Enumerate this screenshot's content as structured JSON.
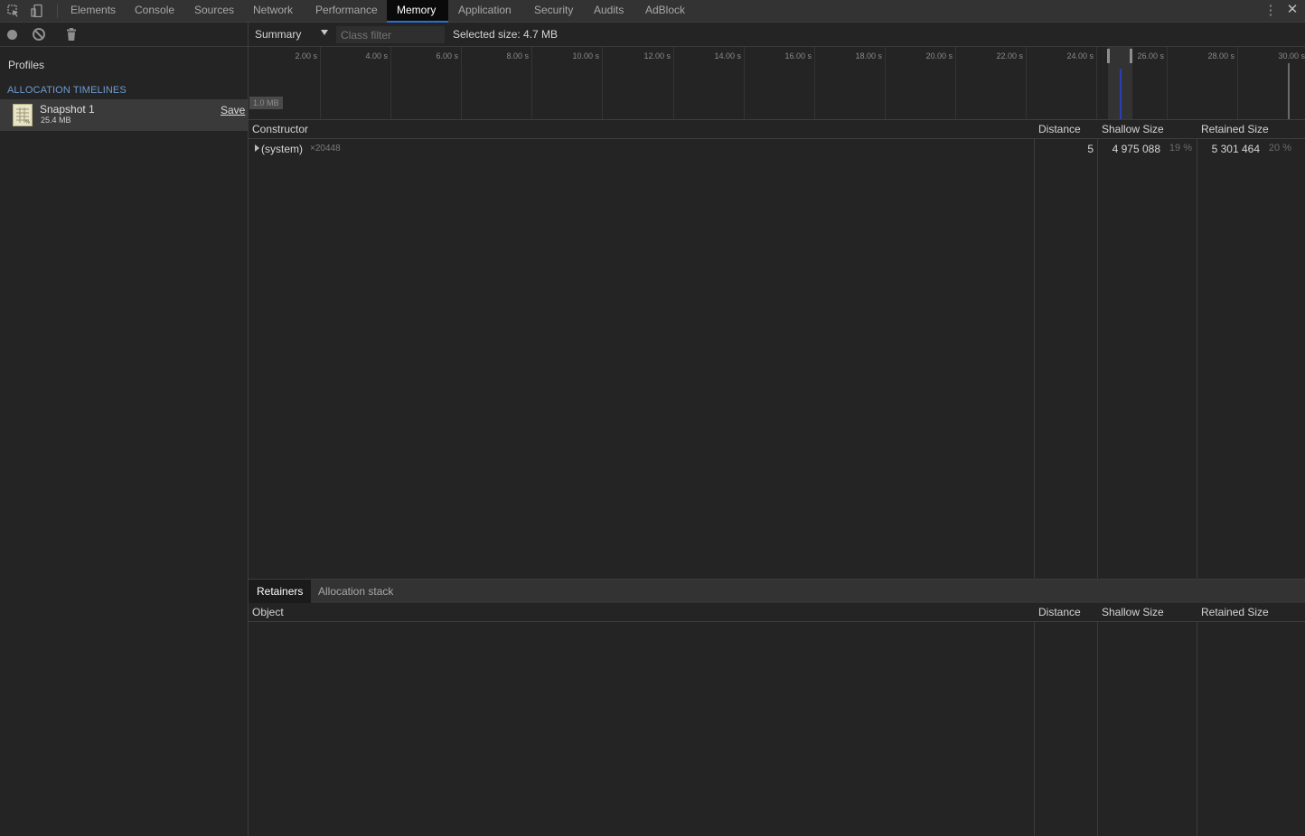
{
  "tabs": [
    "Elements",
    "Console",
    "Sources",
    "Network",
    "Performance",
    "Memory",
    "Application",
    "Security",
    "Audits",
    "AdBlock"
  ],
  "active_tab": "Memory",
  "sidebar": {
    "title": "Profiles",
    "section_header": "ALLOCATION TIMELINES",
    "snapshot": {
      "name": "Snapshot 1",
      "size": "25.4 MB",
      "save_label": "Save"
    }
  },
  "toolbar": {
    "view": "Summary",
    "class_filter_placeholder": "Class filter",
    "selected_size": "Selected size: 4.7 MB"
  },
  "timeline": {
    "ticks": [
      "2.00 s",
      "4.00 s",
      "6.00 s",
      "8.00 s",
      "10.00 s",
      "12.00 s",
      "14.00 s",
      "16.00 s",
      "18.00 s",
      "20.00 s",
      "22.00 s",
      "24.00 s",
      "26.00 s",
      "28.00 s",
      "30.00 s"
    ],
    "memory_label": "1.0 MB"
  },
  "grid": {
    "headers": {
      "constructor": "Constructor",
      "distance": "Distance",
      "shallow": "Shallow Size",
      "retained": "Retained Size"
    },
    "rows": [
      {
        "name": "(system)",
        "count": "×20448",
        "distance": "5",
        "shallow": "4 975 088",
        "shallow_pct": "19 %",
        "retained": "5 301 464",
        "retained_pct": "20 %"
      }
    ]
  },
  "bottom": {
    "tabs": [
      "Retainers",
      "Allocation stack"
    ],
    "active": "Retainers",
    "headers": {
      "object": "Object",
      "distance": "Distance",
      "shallow": "Shallow Size",
      "retained": "Retained Size"
    }
  },
  "colors": {
    "accent": "#2a6fd6",
    "section_header": "#6e9bd1",
    "allocation_bar": "#2b3fb8"
  }
}
